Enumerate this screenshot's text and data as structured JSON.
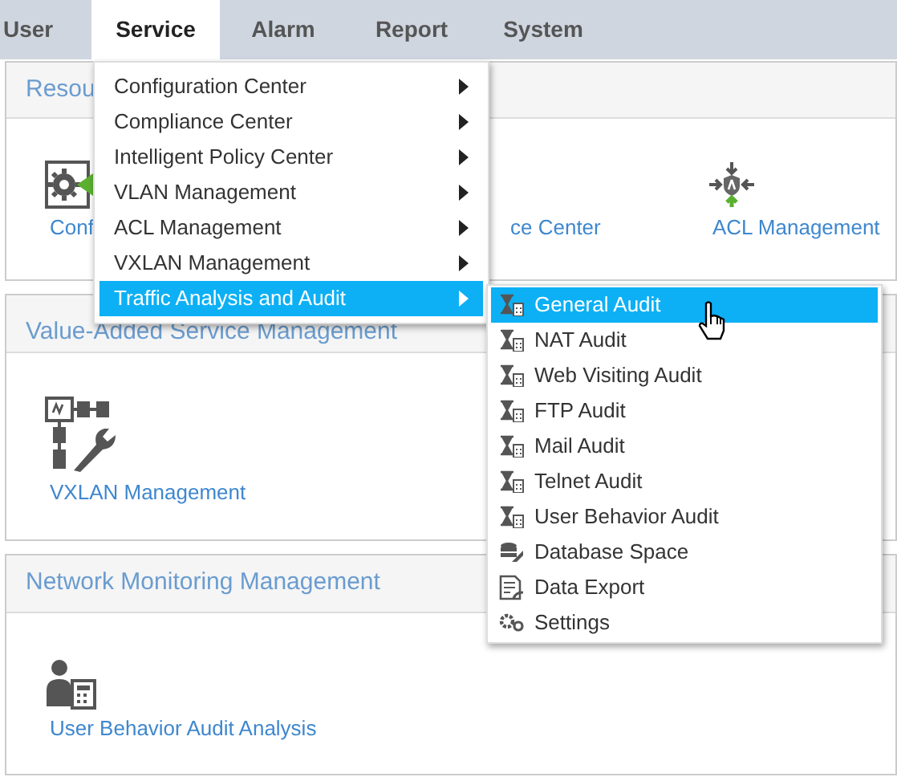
{
  "nav": {
    "tabs": [
      {
        "label": "User",
        "selected": false
      },
      {
        "label": "Service",
        "selected": true
      },
      {
        "label": "Alarm",
        "selected": false
      },
      {
        "label": "Report",
        "selected": false
      },
      {
        "label": "System",
        "selected": false
      }
    ]
  },
  "panels": [
    {
      "title": "Resou",
      "tiles": [
        {
          "label": "Conf",
          "kind": "config"
        },
        {
          "label": "ce Center",
          "kind": "none"
        },
        {
          "label": "ACL Management",
          "kind": "acl"
        }
      ]
    },
    {
      "title": "Value-Added Service Management",
      "tiles": [
        {
          "label": "VXLAN Management",
          "kind": "vxlan"
        }
      ]
    },
    {
      "title": "Network Monitoring Management",
      "tiles": [
        {
          "label": "User Behavior Audit Analysis",
          "kind": "user-audit"
        }
      ]
    }
  ],
  "menu": {
    "items": [
      {
        "label": "Configuration Center",
        "selected": false
      },
      {
        "label": "Compliance Center",
        "selected": false
      },
      {
        "label": "Intelligent Policy Center",
        "selected": false
      },
      {
        "label": "VLAN Management",
        "selected": false
      },
      {
        "label": "ACL Management",
        "selected": false
      },
      {
        "label": "VXLAN Management",
        "selected": false
      },
      {
        "label": "Traffic Analysis and Audit",
        "selected": true
      }
    ]
  },
  "submenu": {
    "items": [
      {
        "label": "General Audit",
        "selected": true,
        "kind": "audit"
      },
      {
        "label": "NAT Audit",
        "selected": false,
        "kind": "audit"
      },
      {
        "label": "Web Visiting Audit",
        "selected": false,
        "kind": "audit"
      },
      {
        "label": "FTP Audit",
        "selected": false,
        "kind": "audit"
      },
      {
        "label": "Mail Audit",
        "selected": false,
        "kind": "audit"
      },
      {
        "label": "Telnet Audit",
        "selected": false,
        "kind": "audit"
      },
      {
        "label": "User Behavior Audit",
        "selected": false,
        "kind": "audit"
      },
      {
        "label": "Database Space",
        "selected": false,
        "kind": "database"
      },
      {
        "label": "Data Export",
        "selected": false,
        "kind": "export"
      },
      {
        "label": "Settings",
        "selected": false,
        "kind": "settings"
      }
    ]
  }
}
